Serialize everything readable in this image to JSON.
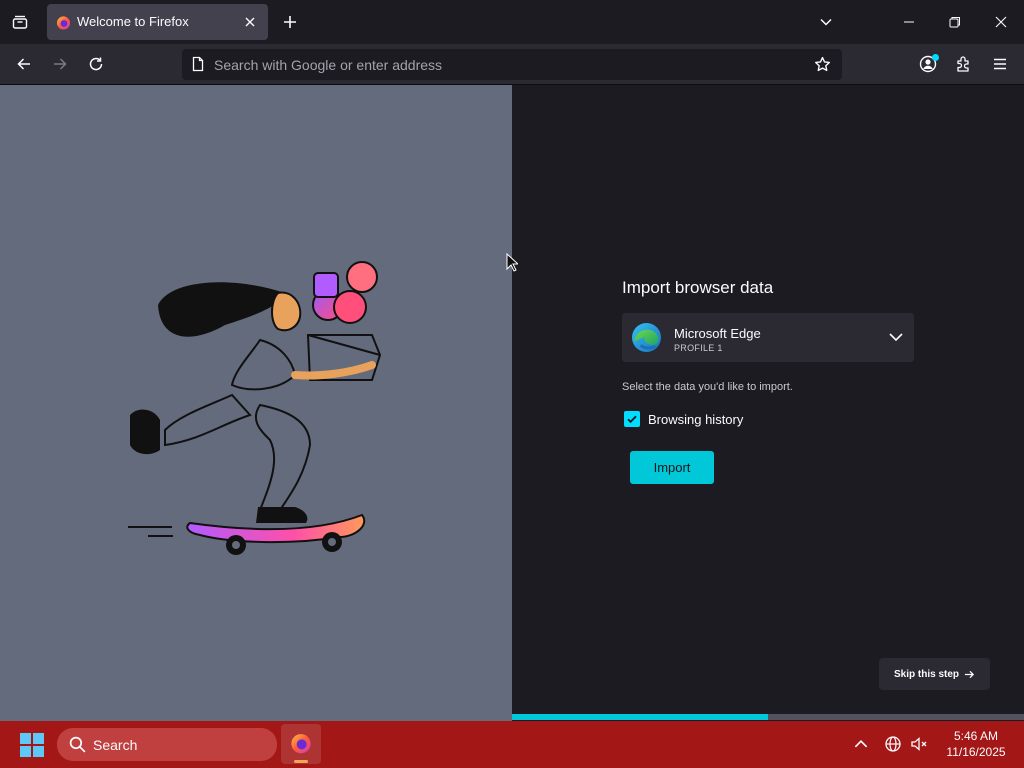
{
  "browser": {
    "tab": {
      "title": "Welcome to Firefox"
    },
    "urlbar": {
      "placeholder": "Search with Google or enter address",
      "value": ""
    }
  },
  "import_panel": {
    "title": "Import browser data",
    "selected_browser": {
      "name": "Microsoft Edge",
      "profile": "PROFILE 1"
    },
    "hint": "Select the data you'd like to import.",
    "options": [
      {
        "label": "Browsing history",
        "checked": true
      }
    ],
    "import_label": "Import",
    "skip_label": "Skip this step",
    "progress": 0.5
  },
  "taskbar": {
    "search_label": "Search",
    "clock": {
      "time": "5:46 AM",
      "date": "11/16/2025"
    }
  },
  "colors": {
    "accent": "#00ddff",
    "taskbar": "#a31717",
    "left_pane": "#646b7c",
    "content_bg": "#1c1b22"
  },
  "icons": [
    "tab-list-icon",
    "firefox-icon",
    "close-icon",
    "plus-icon",
    "chevron-down-icon",
    "minimize-icon",
    "restore-icon",
    "back-icon",
    "forward-icon",
    "reload-icon",
    "page-icon",
    "star-icon",
    "account-icon",
    "extensions-icon",
    "hamburger-menu-icon",
    "edge-icon",
    "check-icon",
    "arrow-right-icon",
    "windows-start-icon",
    "search-icon",
    "network-icon",
    "volume-icon"
  ]
}
